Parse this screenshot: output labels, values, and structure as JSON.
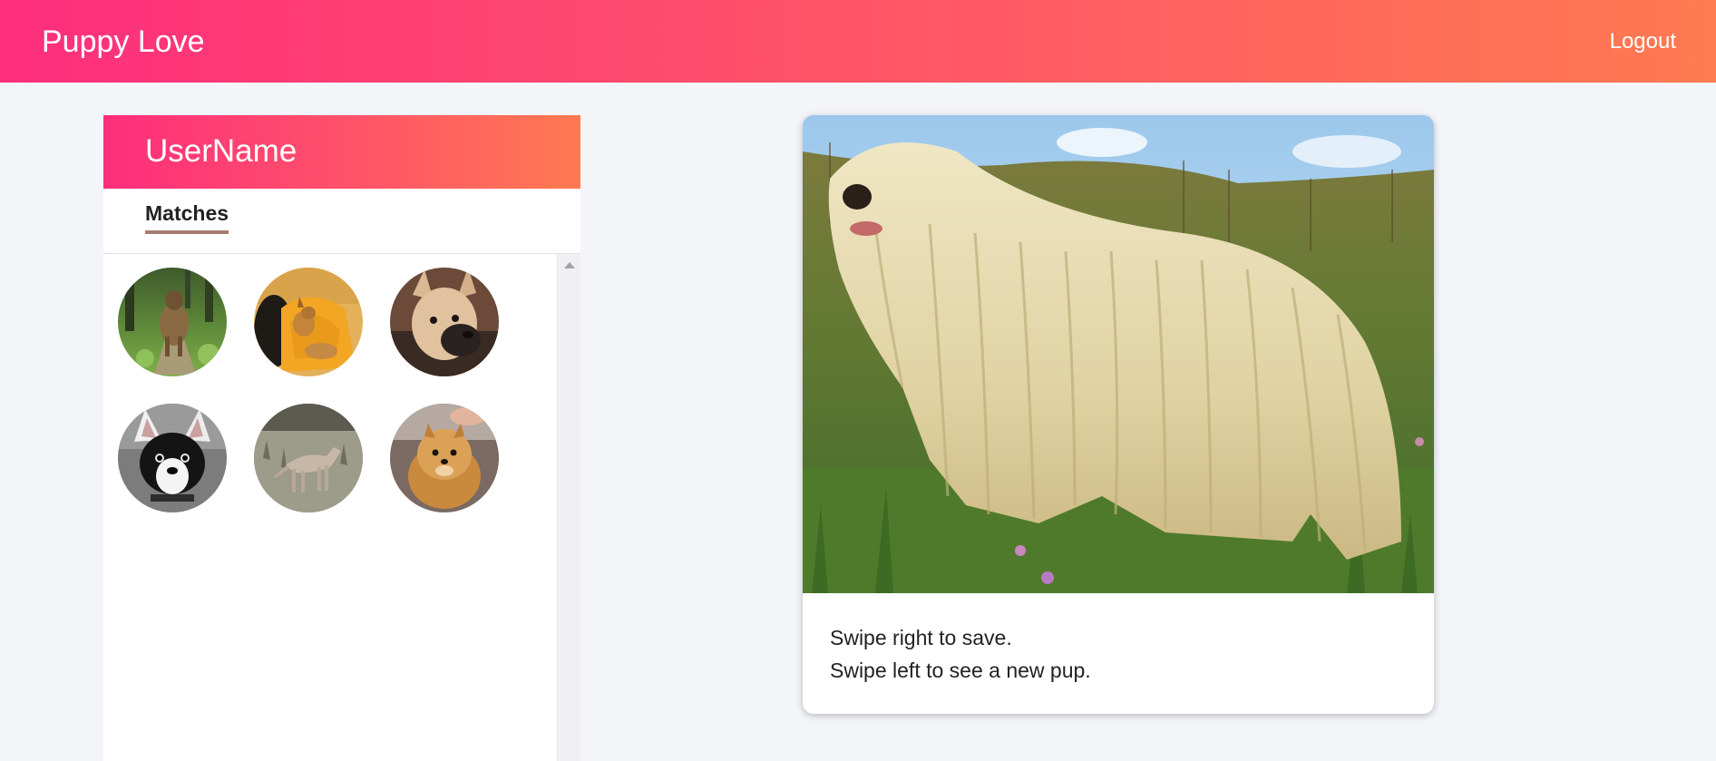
{
  "header": {
    "brand": "Puppy Love",
    "logout_label": "Logout"
  },
  "sidebar": {
    "username": "UserName",
    "tabs": [
      {
        "label": "Matches",
        "active": true
      }
    ],
    "matches": [
      {
        "name": "match-1",
        "description": "long-haired dog on forest path"
      },
      {
        "name": "match-2",
        "description": "tan dog curled on yellow blanket"
      },
      {
        "name": "match-3",
        "description": "fawn puppy with black muzzle"
      },
      {
        "name": "match-4",
        "description": "black and white chihuahua"
      },
      {
        "name": "match-5",
        "description": "slim grey dog in grass field"
      },
      {
        "name": "match-6",
        "description": "orange pomeranian"
      }
    ]
  },
  "card": {
    "instructions": [
      "Swipe right to save.",
      "Swipe left to see a new pup."
    ]
  },
  "colors": {
    "gradient_start": "#fd2e7c",
    "gradient_end": "#ff7a50",
    "tab_underline": "#a67c72",
    "background": "#f4f5f9"
  },
  "icons": {
    "scroll_up": "triangle-up-icon"
  }
}
